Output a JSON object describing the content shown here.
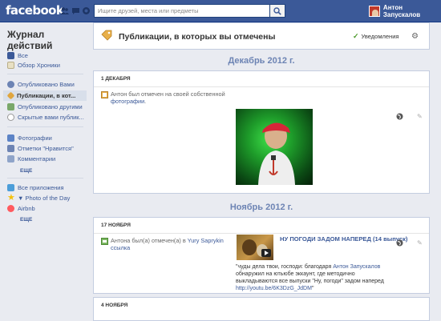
{
  "topbar": {
    "logo": "facebook",
    "search_placeholder": "Ищите друзей, места или предметы",
    "user_name": "Антон Запускалов"
  },
  "sidebar": {
    "title": "Журнал действий",
    "items_a": [
      {
        "label": "Все",
        "icon": "facebook-icon",
        "color": "#3b5998"
      },
      {
        "label": "Обзор Хроники",
        "icon": "timeline-icon",
        "color": "#e8e0c4"
      }
    ],
    "items_b": [
      {
        "label": "Опубликовано Вами",
        "icon": "person-icon",
        "color": "#6d84b4"
      },
      {
        "label": "Публикации, в кот...",
        "icon": "tag-icon",
        "color": "#e0a640",
        "active": true
      },
      {
        "label": "Опубликовано другими",
        "icon": "people-icon",
        "color": "#7aa86a"
      },
      {
        "label": "Скрытые вами публик...",
        "icon": "hidden-icon",
        "color": "#999999"
      }
    ],
    "items_c": [
      {
        "label": "Фотографии",
        "icon": "photos-icon",
        "color": "#5c83c6"
      },
      {
        "label": "Отметки \"Нравится\"",
        "icon": "like-icon",
        "color": "#6d84b4"
      },
      {
        "label": "Комментарии",
        "icon": "comment-icon",
        "color": "#8fa4c9"
      }
    ],
    "more_1": "ЕЩЕ",
    "items_d": [
      {
        "label": "Все приложения",
        "icon": "apps-icon",
        "color": "#4c9ed9"
      },
      {
        "label": "▼ Photo of the Day",
        "icon": "star-icon",
        "color": "#f4c20d"
      },
      {
        "label": "Airbnb",
        "icon": "airbnb-icon",
        "color": "#ff5a5f"
      }
    ],
    "more_2": "ЕЩЕ"
  },
  "header": {
    "title": "Публикации, в которых вы отмечены",
    "notifications": "Уведомления"
  },
  "sections": [
    {
      "month": "Декабрь 2012 г.",
      "date": "1 ДЕКАБРЯ",
      "story_pre": "Антон был отмечен на своей собственной",
      "story_link": "фотографии",
      "story_post": "."
    },
    {
      "month": "Ноябрь 2012 г.",
      "date": "17 НОЯБРЯ",
      "story_pre": "Антона был(а) отмечен(а) в",
      "story_link1": "Yury Saprykin",
      "story_link2": "ссылка",
      "video_title": "НУ ПОГОДИ ЗАДОМ НАПЕРЕД (14 выпуск)",
      "quote_pre": "\"чуды дела твои, господи: благодаря",
      "quote_link": "Антон Запускалов",
      "quote_mid": "обнаружил на ютьюбе эккаунт, где методично выкладываются все выпуски \"Ну, погоди\" задом наперед",
      "quote_url": "http://youtu.be/6K3DzG_JdDM",
      "quote_end": "\""
    },
    {
      "date": "4 НОЯБРЯ"
    }
  ]
}
